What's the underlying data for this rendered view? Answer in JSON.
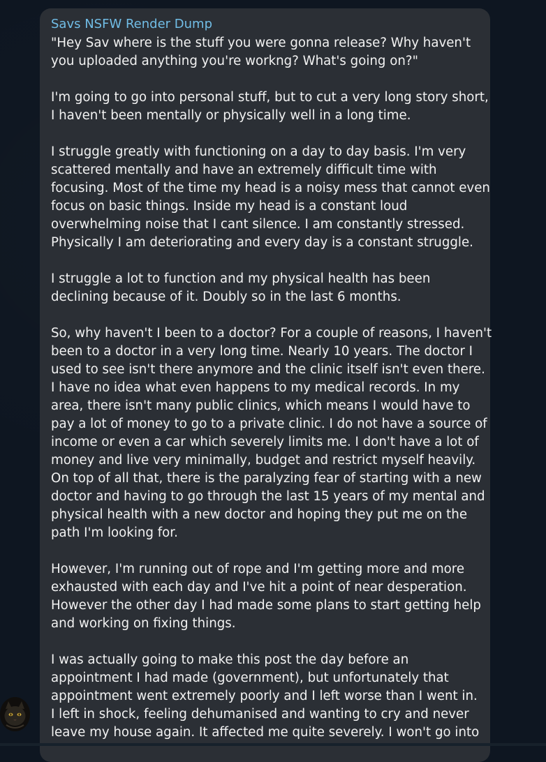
{
  "message": {
    "sender": "Savs NSFW Render Dump",
    "paragraphs": [
      [
        "\"Hey Sav where is the stuff you were gonna release? Why haven't",
        "you uploaded anything you're workng? What's going on?\""
      ],
      [
        "I'm going to go into personal stuff, but to cut a very long story short,",
        "I haven't been mentally or physically well in a long time."
      ],
      [
        "I struggle greatly with functioning on a day to day basis. I'm very",
        "scattered mentally and have an extremely difficult time with",
        "focusing. Most of the time my head is a noisy mess that cannot even",
        "focus on basic things. Inside my head is a constant loud",
        "overwhelming noise that I cant silence. I am constantly stressed.",
        "Physically I am deteriorating and every day is a constant struggle."
      ],
      [
        "I struggle a lot to function and my physical health has been",
        "declining because of it. Doubly so in the last 6 months."
      ],
      [
        "So, why haven't I been to a doctor? For a couple of reasons, I haven't",
        "been to a doctor in a very long time. Nearly 10 years. The doctor I",
        "used to see isn't there anymore and the clinic itself isn't even there.",
        "I have no idea what even happens to my medical records. In my",
        "area, there isn't many public clinics, which means I would have to",
        "pay a lot of money to go to a private clinic. I do not have a source of",
        "income or even a car which severely limits me. I don't have a lot of",
        "money and live very minimally, budget and restrict myself heavily.",
        "On top of all that, there is the paralyzing fear of starting with a new",
        "doctor and having to go through the last 15 years of my mental and",
        "physical health with a new doctor and hoping they put me on the",
        "path I'm looking for."
      ],
      [
        "However, I'm running out of rope and I'm getting more and more",
        "exhausted with each day and I've hit a point of near desperation.",
        "However the other day I had made some plans to start getting help",
        "and working on fixing things."
      ],
      [
        "I was actually going to make this post the day before an",
        "appointment I had made (government), but unfortunately that",
        "appointment went extremely poorly and I left worse than I went in.",
        "I left in shock, feeling dehumanised and wanting to cry and never",
        "leave my house again. It affected me quite severely. I won't go into"
      ]
    ]
  },
  "colors": {
    "background": "#0e1621",
    "bubble": "#2b2f35",
    "sender_name": "#71bde6",
    "text": "#f2f2f2"
  }
}
